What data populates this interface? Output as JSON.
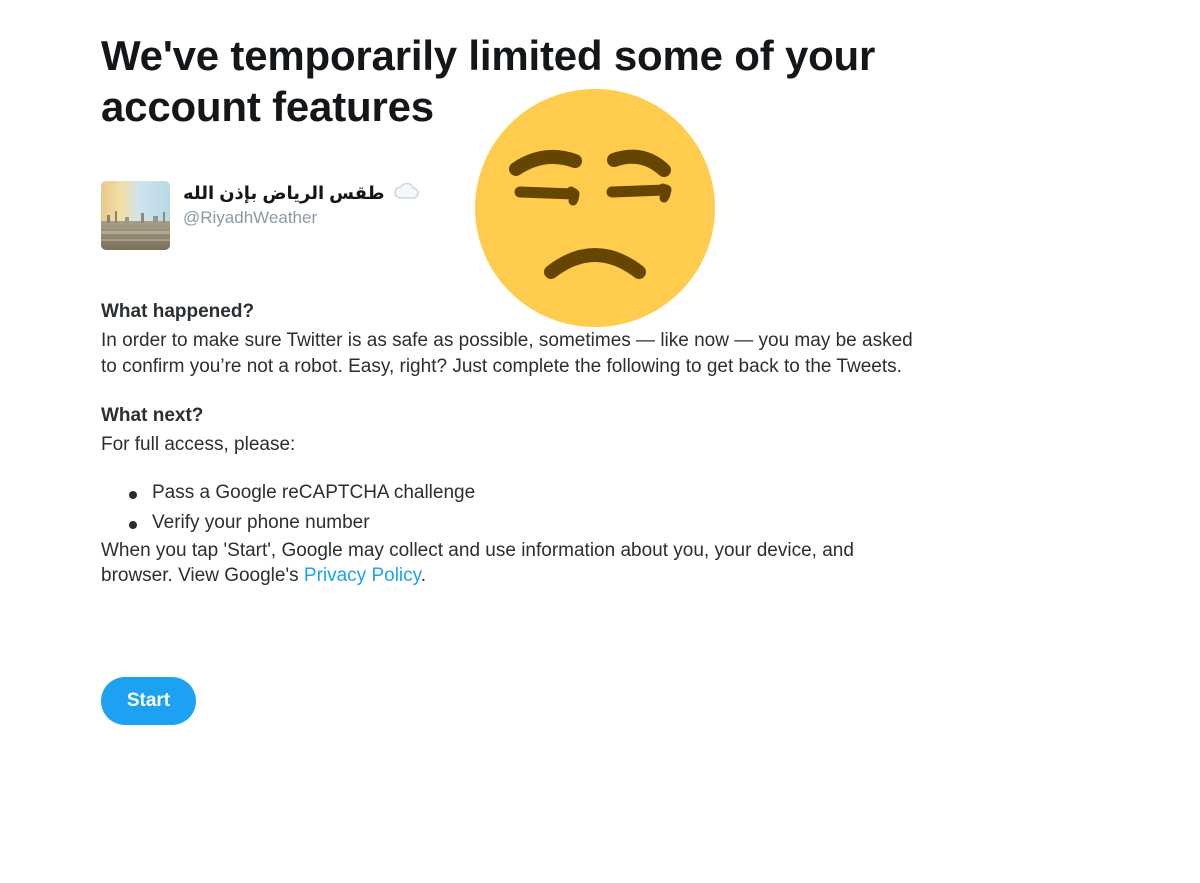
{
  "title": "We've temporarily limited some of your account features",
  "account": {
    "display_name": "طقس الرياض بإذن الله",
    "handle": "@RiyadhWeather",
    "name_icon": "cloud-icon"
  },
  "overlay_icon": "unamused-face-emoji",
  "what_happened": {
    "heading": "What happened?",
    "body": "In order to make sure Twitter is as safe as possible, sometimes — like now — you may be asked to confirm you’re not a robot. Easy, right? Just complete the following to get back to the Tweets."
  },
  "what_next": {
    "heading": "What next?",
    "intro": "For full access, please:",
    "steps": [
      "Pass a Google reCAPTCHA challenge",
      "Verify your phone number"
    ],
    "notice": "When you tap 'Start', Google may collect and use information about you, your device, and browser. View Google's",
    "link_label": "Privacy Policy",
    "notice_end": "."
  },
  "start_button": "Start",
  "colors": {
    "accent": "#1da1f2",
    "text": "#292f33",
    "muted": "#8899a6",
    "emoji_face": "#ffcc4d",
    "emoji_features": "#664500"
  }
}
